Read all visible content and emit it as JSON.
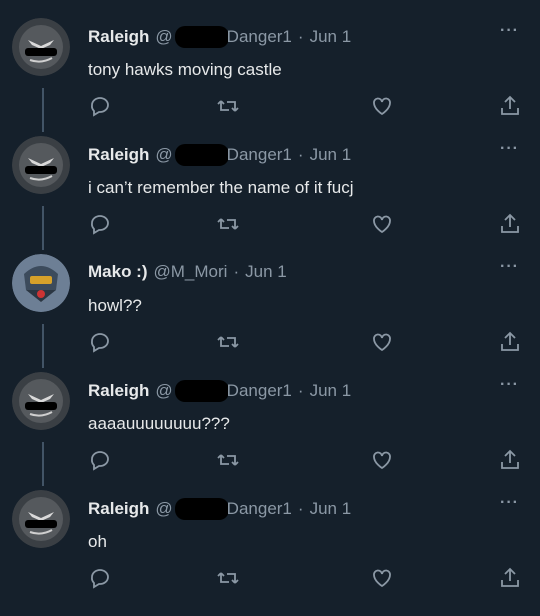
{
  "tweets": [
    {
      "name": "Raleigh",
      "at": "@",
      "handle_suffix": "Danger1",
      "sep": "·",
      "date": "Jun 1",
      "text": "tony hawks moving castle",
      "avatar": "raleigh"
    },
    {
      "name": "Raleigh",
      "at": "@",
      "handle_suffix": "Danger1",
      "sep": "·",
      "date": "Jun 1",
      "text": "i can’t remember the name of it fucj",
      "avatar": "raleigh"
    },
    {
      "name": "Mako :)",
      "at": "@M_Mori",
      "handle_suffix": "",
      "sep": "·",
      "date": "Jun 1",
      "text": "howl??",
      "avatar": "mako"
    },
    {
      "name": "Raleigh",
      "at": "@",
      "handle_suffix": "Danger1",
      "sep": "·",
      "date": "Jun 1",
      "text": "aaaauuuuuuuu???",
      "avatar": "raleigh"
    },
    {
      "name": "Raleigh",
      "at": "@",
      "handle_suffix": "Danger1",
      "sep": "·",
      "date": "Jun 1",
      "text": "oh",
      "avatar": "raleigh"
    }
  ],
  "more_label": "···",
  "icons": [
    "reply-icon",
    "retweet-icon",
    "like-icon",
    "share-icon"
  ],
  "colors": {
    "background": "#15202b",
    "text": "#e7e9ea",
    "muted": "#8b98a5",
    "thread_line": "#425466"
  }
}
